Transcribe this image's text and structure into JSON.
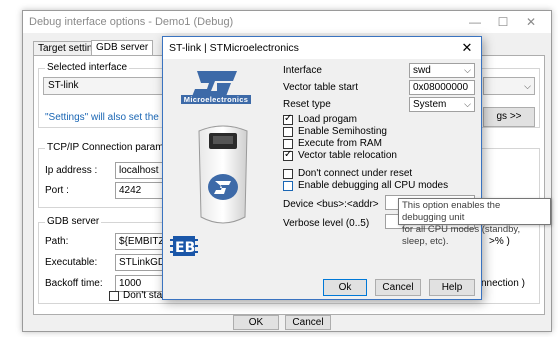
{
  "bg_window": {
    "title": "Debug interface options - Demo1 (Debug)",
    "minimize_glyph": "—",
    "maximize_glyph": "☐",
    "close_glyph": "✕",
    "tabs": [
      "Target settings",
      "GDB server"
    ],
    "selected_interface_label": "Selected interface",
    "interface_value": "ST-link",
    "settings_note": "\"Settings\" will also set the generi",
    "settings_button": "gs >>",
    "right_combo_value": "",
    "tcpip_label": "TCP/IP Connection parameters",
    "ip_label": "Ip address :",
    "ip_value": "localhost",
    "port_label": "Port :",
    "port_value": "4242",
    "gdb_server_label": "GDB server",
    "path_label": "Path:",
    "path_value": "${EMBITZ}\\s",
    "path_suffix": ">% )",
    "exe_label": "Executable:",
    "exe_value": "STLinkGDB.e",
    "backoff_label": "Backoff time:",
    "backoff_value": "1000",
    "backoff_suffix": "nnection )",
    "dont_start_label": "Don't start t",
    "ok": "OK",
    "cancel": "Cancel"
  },
  "dialog": {
    "title": "ST-link | STMicroelectronics",
    "close_glyph": "✕",
    "logo_text": "Microelectronics",
    "interface_label": "Interface",
    "interface_value": "swd",
    "vector_table_label": "Vector table start",
    "vector_table_value": "0x08000000",
    "reset_type_label": "Reset type",
    "reset_type_value": "System",
    "checkboxes": [
      {
        "label": "Load progam",
        "checked": true
      },
      {
        "label": "Enable Semihosting",
        "checked": false
      },
      {
        "label": "Execute from RAM",
        "checked": false
      },
      {
        "label": "Vector table relocation",
        "checked": true
      }
    ],
    "dont_connect_label": "Don't connect under reset",
    "enable_debugging_label": "Enable debugging all CPU modes",
    "device_label": "Device <bus>:<addr>",
    "verbose_label": "Verbose level (0..5)",
    "ok": "Ok",
    "cancel": "Cancel",
    "help": "Help"
  },
  "tooltip": {
    "line1": "This option enables the debugging unit",
    "line2": "for all CPU modes (standby, sleep, etc)."
  },
  "colors": {
    "accent": "#0078d7",
    "st_blue": "#3d6aa8",
    "note_blue": "#1a66b4"
  }
}
